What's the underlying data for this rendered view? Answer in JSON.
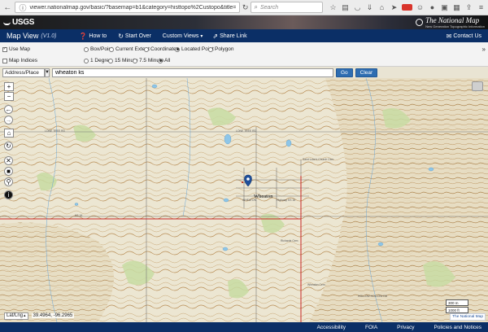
{
  "browser": {
    "url": "viewer.nationalmap.gov/basic/?basemap=b1&category=histtopo%2Custopo&title=",
    "search_placeholder": "Search"
  },
  "banner": {
    "usgs": "USGS",
    "nm_name": "The National Map",
    "nm_subtitle": "New Generation Topographic Information"
  },
  "header": {
    "title": "Map View",
    "version": "(V1.0)",
    "how_to": "How to",
    "start_over": "Start Over",
    "custom_views": "Custom Views",
    "share_link": "Share Link",
    "contact_us": "Contact Us"
  },
  "options": {
    "use_map": "Use Map",
    "map_indices": "Map Indices",
    "box_point": "Box/Point",
    "current_extent": "Current Extent",
    "coordinates": "Coordinates",
    "located_point": "Located Point",
    "polygon": "Polygon",
    "one_degree": "1 Degree",
    "fifteen_minute": "15 Minute",
    "seven_five_minute": "7.5 Minute",
    "all": "All",
    "selected": "located_point"
  },
  "search": {
    "type_value": "Address/Place",
    "query": "wheaton ks",
    "go": "Go",
    "clear": "Clear"
  },
  "map": {
    "town": "Wheaton",
    "labels": {
      "lone_tree_rd_w": "LONE TREE RD",
      "lone_tree_rd_e": "LONE TREE RD",
      "ks16": "KS 16",
      "saint_luke": "Saint Luke's Church Cem",
      "richards": "Richards Cem",
      "wheaton_cem": "Wheaton Cem",
      "hollow_rd": "HOLLOW HOLLOW RD",
      "hwy": "Highway KS 16",
      "wheaton_w": "WHEATON"
    },
    "scale_m": "300 m",
    "scale_ft": "1000 ft",
    "credit": "The National Map"
  },
  "coords": {
    "mode": "Lat/Lng",
    "value": "39.4964, -96.2965"
  },
  "footer": {
    "accessibility": "Accessibility",
    "foia": "FOIA",
    "privacy": "Privacy",
    "policies": "Policies and Notices"
  }
}
